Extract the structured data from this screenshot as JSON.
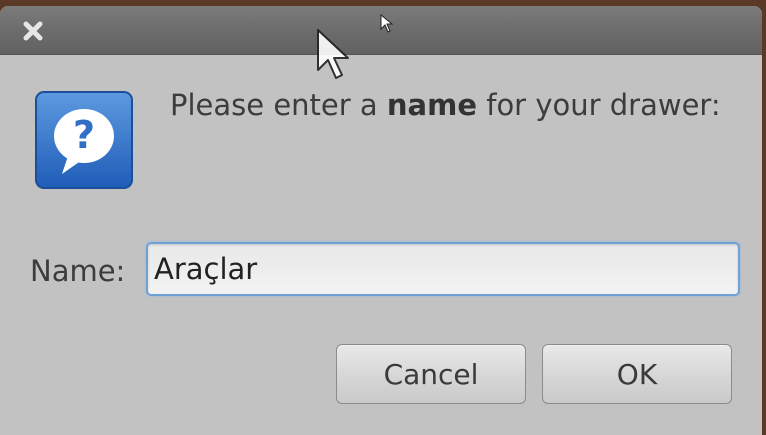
{
  "dialog": {
    "close_icon": "close-icon",
    "icon": "question-icon",
    "prompt_pre": "Please enter a ",
    "prompt_bold": "name",
    "prompt_post": " for your drawer:",
    "name_label": "Name:",
    "name_value": "Araçlar",
    "cancel_label": "Cancel",
    "ok_label": "OK"
  },
  "colors": {
    "accent": "#6fa0d6",
    "icon_blue": "#2f6fc6",
    "dialog_bg": "#c2c2c2",
    "titlebar": "#6e6e6e"
  }
}
